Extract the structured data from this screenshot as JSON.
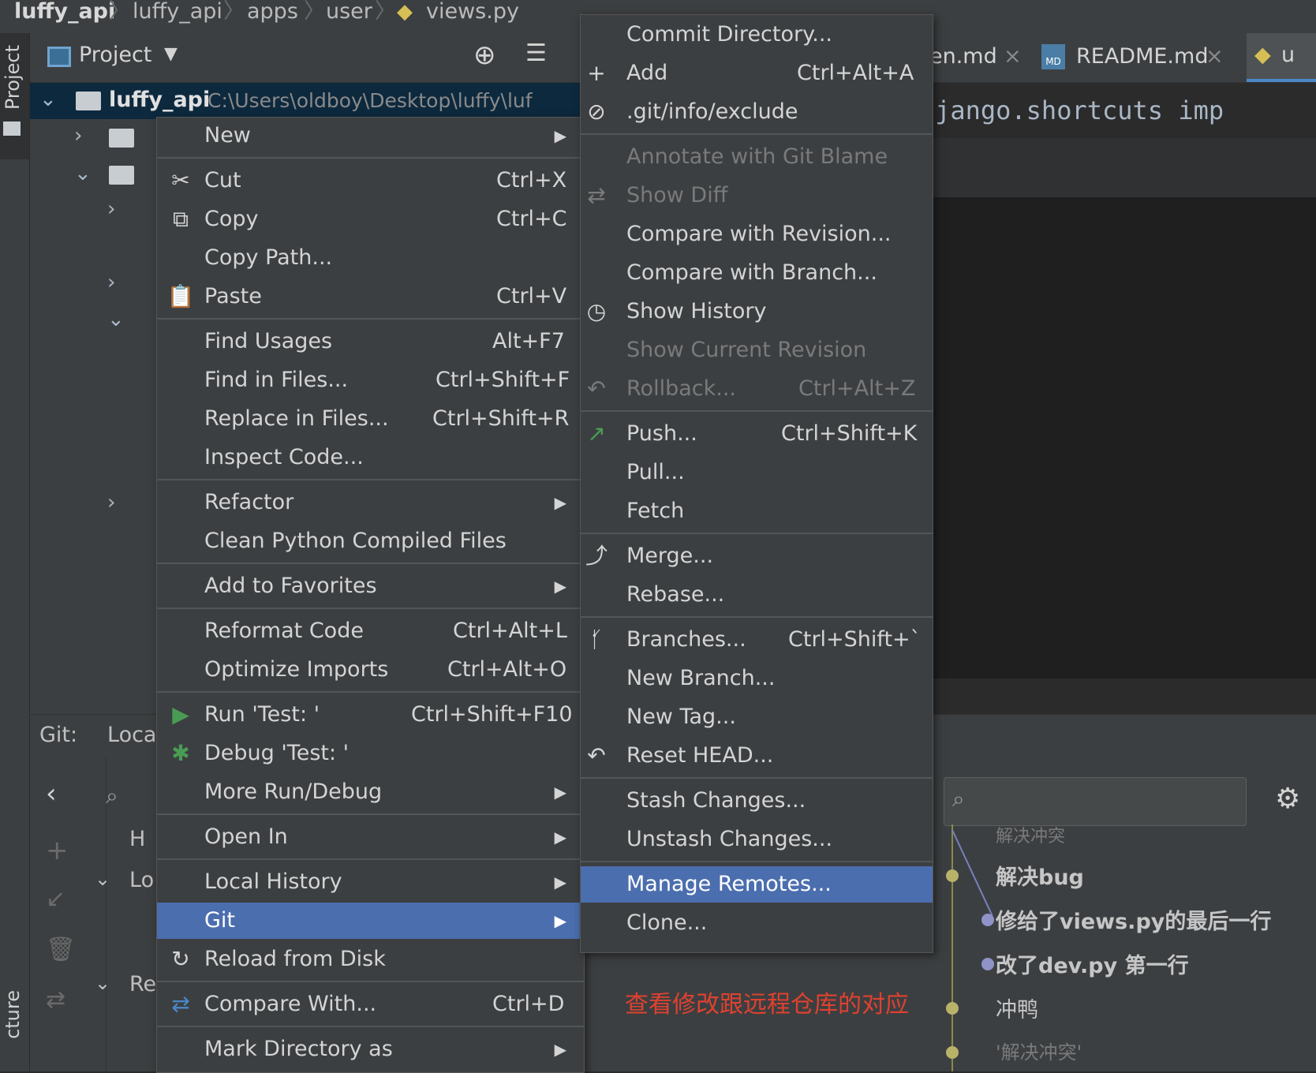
{
  "breadcrumb": [
    "luffy_api",
    "luffy_api",
    "apps",
    "user",
    "views.py"
  ],
  "left_strip": {
    "project_label": "Project",
    "structure_label": "cture"
  },
  "project_panel": {
    "title": "Project",
    "root_name": "luffy_api",
    "root_path": "C:\\Users\\oldboy\\Desktop\\luffy\\luf"
  },
  "editor": {
    "tabs": [
      {
        "label": "en.md",
        "close": "×"
      },
      {
        "label": "README.md",
        "close": "×",
        "badge": "MD"
      },
      {
        "label": "u"
      }
    ],
    "code_line": "om django.shortcuts imp"
  },
  "git_panel": {
    "title": "Git:",
    "local_tab": "Loca",
    "tree_labels": [
      "H",
      "Lo",
      "Re"
    ],
    "log_entries": [
      "解决冲突",
      "解决bug",
      "修给了views.py的最后一行",
      "改了dev.py 第一行",
      "冲鸭",
      "'解决冲突'"
    ]
  },
  "context_menu": {
    "items": [
      {
        "label": "New",
        "shortcut": "",
        "submenu": true
      },
      {
        "label": "Cut",
        "shortcut": "Ctrl+X",
        "icon": "scissors"
      },
      {
        "label": "Copy",
        "shortcut": "Ctrl+C",
        "icon": "copy"
      },
      {
        "label": "Copy Path...",
        "shortcut": ""
      },
      {
        "label": "Paste",
        "shortcut": "Ctrl+V",
        "icon": "clipboard"
      },
      {
        "label": "Find Usages",
        "shortcut": "Alt+F7"
      },
      {
        "label": "Find in Files...",
        "shortcut": "Ctrl+Shift+F"
      },
      {
        "label": "Replace in Files...",
        "shortcut": "Ctrl+Shift+R"
      },
      {
        "label": "Inspect Code...",
        "shortcut": ""
      },
      {
        "label": "Refactor",
        "shortcut": "",
        "submenu": true
      },
      {
        "label": "Clean Python Compiled Files",
        "shortcut": ""
      },
      {
        "label": "Add to Favorites",
        "shortcut": "",
        "submenu": true
      },
      {
        "label": "Reformat Code",
        "shortcut": "Ctrl+Alt+L"
      },
      {
        "label": "Optimize Imports",
        "shortcut": "Ctrl+Alt+O"
      },
      {
        "label": "Run 'Test: '",
        "shortcut": "Ctrl+Shift+F10",
        "icon": "run"
      },
      {
        "label": "Debug 'Test: '",
        "shortcut": "",
        "icon": "bug"
      },
      {
        "label": "More Run/Debug",
        "shortcut": "",
        "submenu": true
      },
      {
        "label": "Open In",
        "shortcut": "",
        "submenu": true
      },
      {
        "label": "Local History",
        "shortcut": "",
        "submenu": true
      },
      {
        "label": "Git",
        "shortcut": "",
        "submenu": true,
        "selected": true
      },
      {
        "label": "Reload from Disk",
        "shortcut": "",
        "icon": "reload"
      },
      {
        "label": "Compare With...",
        "shortcut": "Ctrl+D",
        "icon": "compare"
      },
      {
        "label": "Mark Directory as",
        "shortcut": "",
        "submenu": true
      }
    ]
  },
  "git_menu": {
    "items": [
      {
        "label": "Commit Directory...",
        "shortcut": ""
      },
      {
        "label": "Add",
        "shortcut": "Ctrl+Alt+A",
        "icon": "plus"
      },
      {
        "label": ".git/info/exclude",
        "shortcut": "",
        "icon": "ignore-file"
      },
      {
        "label": "Annotate with Git Blame",
        "shortcut": "",
        "disabled": true
      },
      {
        "label": "Show Diff",
        "shortcut": "",
        "disabled": true,
        "icon": "diff"
      },
      {
        "label": "Compare with Revision...",
        "shortcut": ""
      },
      {
        "label": "Compare with Branch...",
        "shortcut": ""
      },
      {
        "label": "Show History",
        "shortcut": "",
        "icon": "clock"
      },
      {
        "label": "Show Current Revision",
        "shortcut": "",
        "disabled": true
      },
      {
        "label": "Rollback...",
        "shortcut": "Ctrl+Alt+Z",
        "disabled": true,
        "icon": "undo"
      },
      {
        "label": "Push...",
        "shortcut": "Ctrl+Shift+K",
        "icon": "push-arrow"
      },
      {
        "label": "Pull...",
        "shortcut": ""
      },
      {
        "label": "Fetch",
        "shortcut": ""
      },
      {
        "label": "Merge...",
        "shortcut": "",
        "icon": "merge"
      },
      {
        "label": "Rebase...",
        "shortcut": ""
      },
      {
        "label": "Branches...",
        "shortcut": "Ctrl+Shift+`",
        "icon": "branch"
      },
      {
        "label": "New Branch...",
        "shortcut": ""
      },
      {
        "label": "New Tag...",
        "shortcut": ""
      },
      {
        "label": "Reset HEAD...",
        "shortcut": "",
        "icon": "undo"
      },
      {
        "label": "Stash Changes...",
        "shortcut": ""
      },
      {
        "label": "Unstash Changes...",
        "shortcut": ""
      },
      {
        "label": "Manage Remotes...",
        "shortcut": "",
        "selected": true
      },
      {
        "label": "Clone...",
        "shortcut": ""
      }
    ]
  },
  "annotation": "查看修改跟远程仓库的对应",
  "colors": {
    "selection": "#4b6eaf",
    "annotation": "#e0412f",
    "run_green": "#499c54"
  }
}
